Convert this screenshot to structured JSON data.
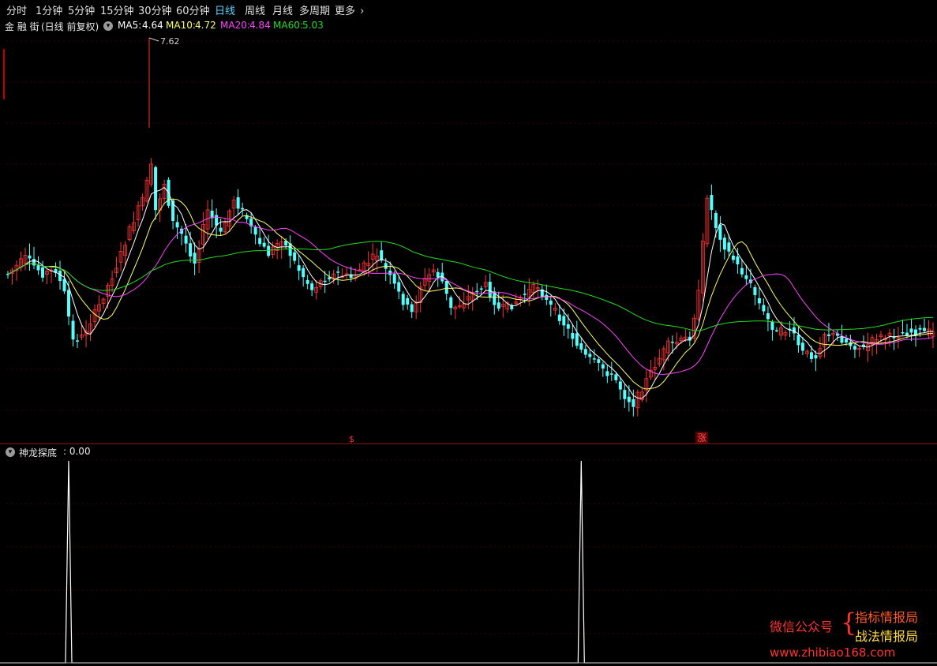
{
  "periods": [
    "分时",
    "1分钟",
    "5分钟",
    "15分钟",
    "30分钟",
    "60分钟",
    "日线",
    "周线",
    "月线",
    "多周期",
    "更多"
  ],
  "active_period": "日线",
  "more_chevron": "›",
  "stock": {
    "name": "金 融 街",
    "mode": "(日线 前复权)"
  },
  "ma_legend": [
    {
      "label": "MA5:",
      "value": "4.64",
      "color": "#ffffff"
    },
    {
      "label": "MA10:",
      "value": "4.72",
      "color": "#ffff66"
    },
    {
      "label": "MA20:",
      "value": "4.84",
      "color": "#ff44ff"
    },
    {
      "label": "MA60:",
      "value": "5.03",
      "color": "#22dd22"
    }
  ],
  "high_label": "7.62",
  "signal_marks": [
    {
      "text": "$",
      "color": "#ff3030"
    },
    {
      "text": "涨",
      "color": "#ff5050"
    }
  ],
  "indicator": {
    "name": "神龙探底",
    "value": ": 0.00"
  },
  "watermark": {
    "label": "微信公众号",
    "brace": "{",
    "line1": "指标情报局",
    "line2": "战法情报局",
    "url": "www.zhibiao168.com"
  },
  "colors": {
    "up": "#ff3333",
    "down": "#54ffff",
    "grid": "#3a0000",
    "indicator_line": "#ffffff"
  },
  "indicator_spikes": [
    {
      "bar_index": 14,
      "value": 1
    },
    {
      "bar_index": 132,
      "value": 1
    }
  ]
}
